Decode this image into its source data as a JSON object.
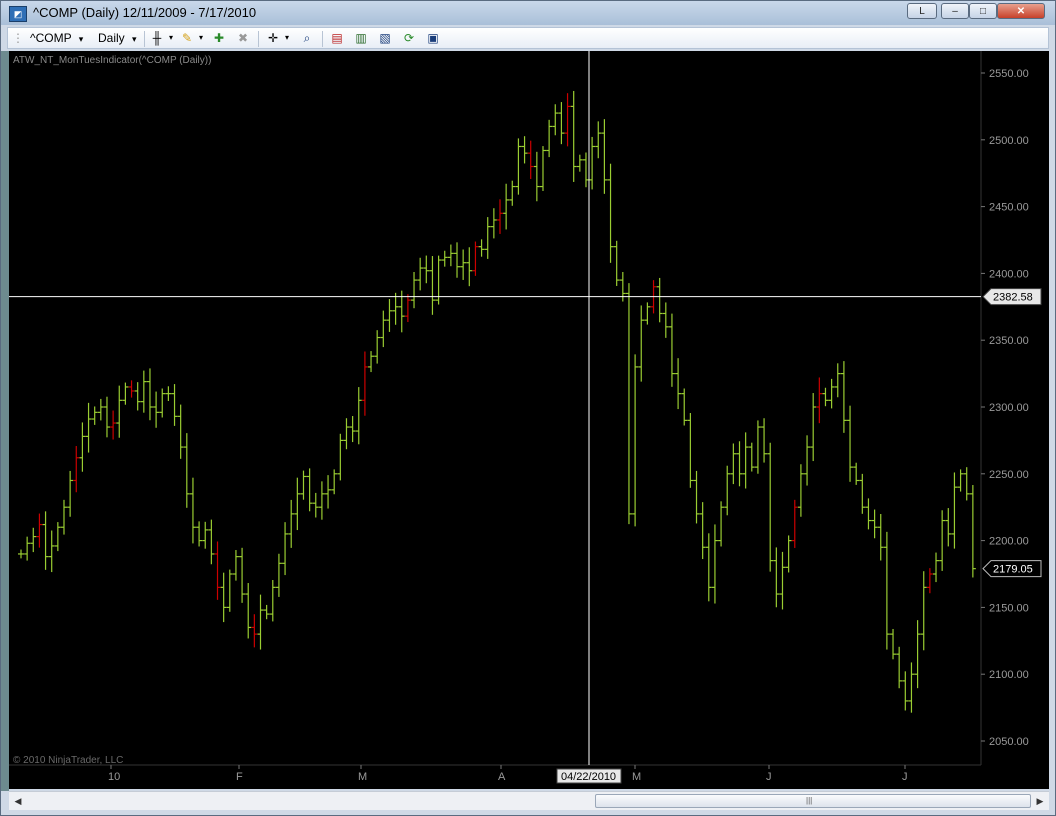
{
  "window": {
    "title": "^COMP (Daily)  12/11/2009 - 7/17/2010",
    "app_icon": "ninjatrader-chart-icon",
    "link_button_label": "L",
    "minimize_glyph": "–",
    "maximize_glyph": "□",
    "close_glyph": "✕"
  },
  "toolbar": {
    "instrument_label": "^COMP",
    "interval_label": "Daily",
    "dropdown_glyph": "▾",
    "icons": [
      "bar-style-icon",
      "drawing-tool-icon",
      "add-indicator-icon",
      "remove-indicator-icon",
      "crosshair-icon",
      "zoom-icon",
      "strategies-icon",
      "chart-trader-icon",
      "data-box-icon",
      "refresh-icon",
      "properties-icon"
    ]
  },
  "chart": {
    "indicator_label": "ATW_NT_MonTuesIndicator(^COMP (Daily))",
    "copyright": "© 2010 NinjaTrader, LLC",
    "crosshair_price_label": "2382.58",
    "crosshair_date_label": "04/22/2010",
    "last_price_label": "2179.05",
    "background_color": "#000000",
    "up_color": "#9ACD32",
    "down_color": "#CC0000",
    "crosshair_color": "#FFFFFF",
    "axis_text_color": "#9a9a9a"
  },
  "chart_data": {
    "type": "ohlc-bar",
    "y_ticks": [
      "2550.00",
      "2500.00",
      "2450.00",
      "2400.00",
      "2350.00",
      "2300.00",
      "2250.00",
      "2200.00",
      "2150.00",
      "2100.00",
      "2050.00"
    ],
    "x_ticks": [
      "10",
      "F",
      "M",
      "A",
      "M",
      "J",
      "J"
    ],
    "ylim": [
      2035,
      2555
    ],
    "crosshair_price": 2382.58,
    "last_price": 2179.05,
    "closes": [
      2190,
      2198,
      2203,
      2212,
      2188,
      2196,
      2210,
      2225,
      2245,
      2262,
      2278,
      2291,
      2296,
      2300,
      2285,
      2288,
      2305,
      2315,
      2312,
      2304,
      2319,
      2300,
      2296,
      2310,
      2310,
      2293,
      2270,
      2235,
      2210,
      2200,
      2208,
      2190,
      2165,
      2150,
      2175,
      2188,
      2160,
      2135,
      2130,
      2148,
      2145,
      2165,
      2183,
      2205,
      2220,
      2235,
      2248,
      2228,
      2225,
      2235,
      2238,
      2250,
      2275,
      2285,
      2282,
      2305,
      2330,
      2338,
      2352,
      2365,
      2372,
      2375,
      2368,
      2380,
      2395,
      2404,
      2402,
      2380,
      2410,
      2412,
      2415,
      2405,
      2408,
      2402,
      2420,
      2418,
      2435,
      2440,
      2445,
      2455,
      2465,
      2495,
      2490,
      2480,
      2465,
      2492,
      2510,
      2520,
      2505,
      2525,
      2480,
      2485,
      2470,
      2495,
      2505,
      2470,
      2420,
      2395,
      2385,
      2220,
      2330,
      2365,
      2375,
      2390,
      2370,
      2360,
      2325,
      2310,
      2290,
      2245,
      2220,
      2195,
      2165,
      2200,
      2225,
      2250,
      2265,
      2250,
      2270,
      2255,
      2285,
      2265,
      2185,
      2160,
      2180,
      2200,
      2225,
      2250,
      2270,
      2300,
      2310,
      2305,
      2315,
      2325,
      2290,
      2255,
      2245,
      2225,
      2215,
      2210,
      2195,
      2130,
      2115,
      2095,
      2080,
      2100,
      2130,
      2165,
      2175,
      2185,
      2215,
      2205,
      2240,
      2250,
      2235,
      2179
    ],
    "down_indices": [
      3,
      9,
      15,
      18,
      32,
      38,
      56,
      63,
      74,
      78,
      83,
      89,
      103,
      126,
      130,
      148
    ]
  }
}
